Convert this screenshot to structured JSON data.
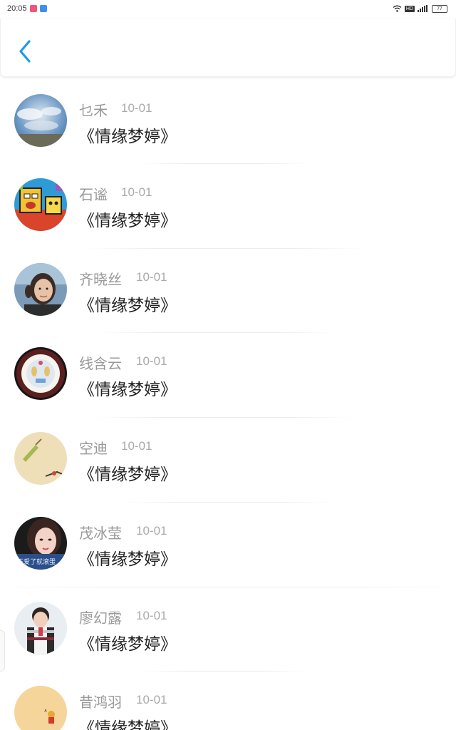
{
  "status_bar": {
    "time": "20:05",
    "hd": "HD",
    "battery": "77"
  },
  "header": {
    "back_icon": "chevron-left-icon",
    "accent": "#1e9be6"
  },
  "list": [
    {
      "name": "乜禾",
      "date": "10-01",
      "title": "《情缘梦婷》"
    },
    {
      "name": "石谧",
      "date": "10-01",
      "title": "《情缘梦婷》"
    },
    {
      "name": "齐晓丝",
      "date": "10-01",
      "title": "《情缘梦婷》"
    },
    {
      "name": "线含云",
      "date": "10-01",
      "title": "《情缘梦婷》"
    },
    {
      "name": "空迪",
      "date": "10-01",
      "title": "《情缘梦婷》"
    },
    {
      "name": "茂冰莹",
      "date": "10-01",
      "title": "《情缘梦婷》"
    },
    {
      "name": "廖幻露",
      "date": "10-01",
      "title": "《情缘梦婷》"
    },
    {
      "name": "昔鸿羽",
      "date": "10-01",
      "title": "《情缘梦婷》"
    }
  ],
  "avatar_6_caption": "不爱了就滚蛋"
}
